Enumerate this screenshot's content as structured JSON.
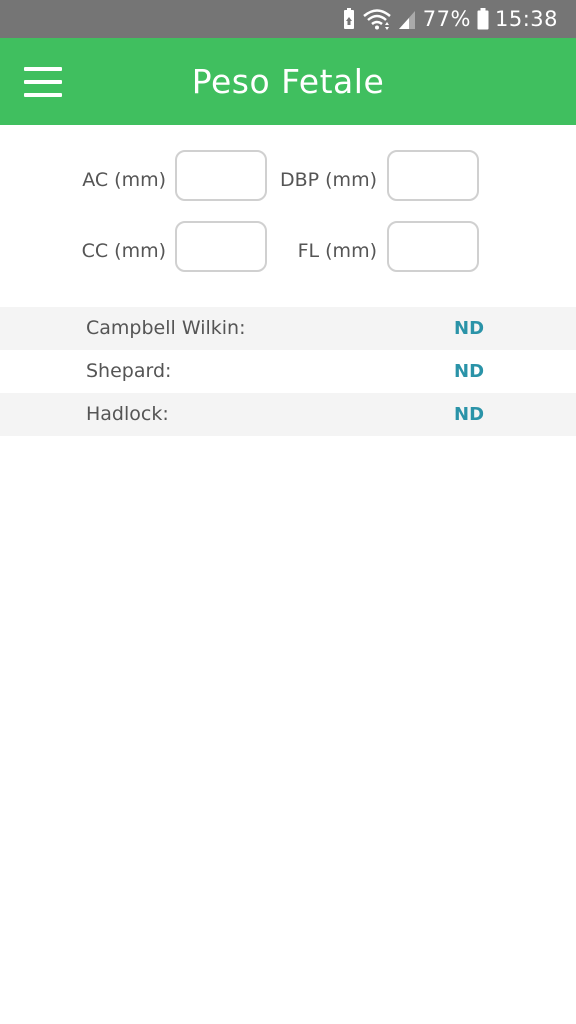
{
  "status_bar": {
    "battery_percent": "77%",
    "time": "15:38",
    "icons": [
      "recycle-battery-icon",
      "wifi-icon",
      "signal-icon",
      "battery-icon"
    ]
  },
  "app_bar": {
    "title": "Peso Fetale",
    "menu_icon": "hamburger-menu-icon",
    "background_color": "#40bf5f"
  },
  "form": {
    "ac_label": "AC (mm)",
    "ac_value": "",
    "dbp_label": "DBP (mm)",
    "dbp_value": "",
    "cc_label": "CC (mm)",
    "cc_value": "",
    "fl_label": "FL (mm)",
    "fl_value": ""
  },
  "results": [
    {
      "label": "Campbell Wilkin:",
      "value": "ND"
    },
    {
      "label": "Shepard:",
      "value": "ND"
    },
    {
      "label": "Hadlock:",
      "value": "ND"
    }
  ],
  "colors": {
    "accent": "#40bf5f",
    "result_value": "#2a93a8",
    "status_bar": "#757575"
  }
}
